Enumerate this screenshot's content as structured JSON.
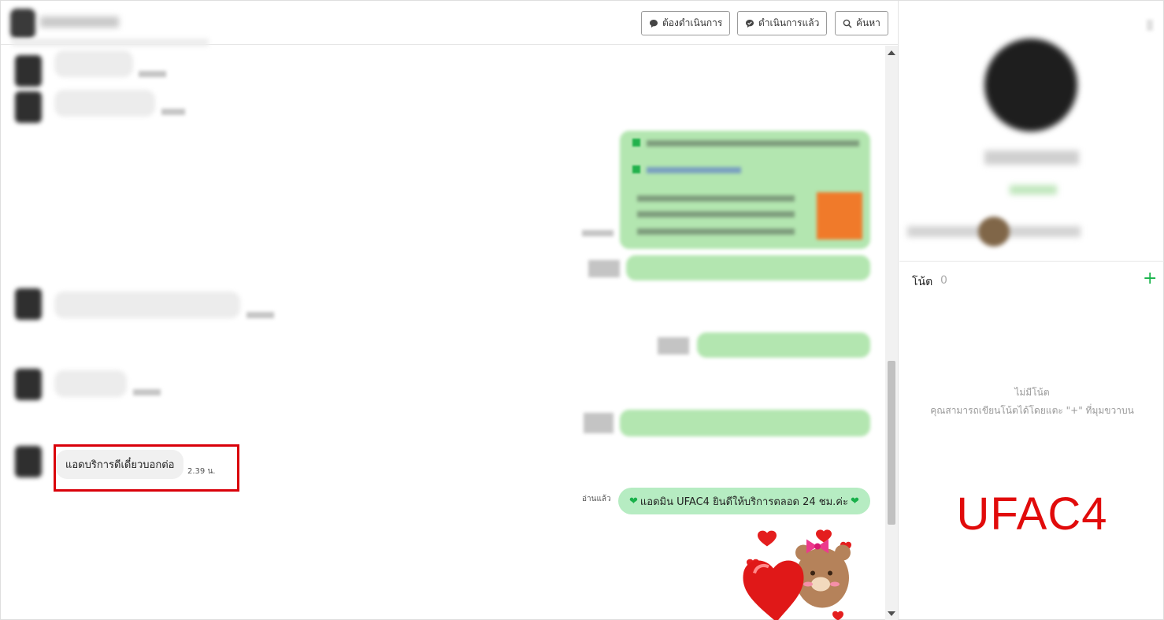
{
  "header": {
    "buttons": [
      {
        "label": "ต้องดำเนินการ",
        "icon": "chat-bubble-icon"
      },
      {
        "label": "ดำเนินการแล้ว",
        "icon": "chat-bubble-check-icon"
      },
      {
        "label": "ค้นหา",
        "icon": "search-icon"
      }
    ]
  },
  "messages": {
    "incoming_highlighted": {
      "text": "แอดบริการดีเดี๋ยวบอกต่อ",
      "time": "2.39 น."
    },
    "outgoing_last": {
      "read_status": "อ่านแล้ว",
      "text": "แอดมิน UFAC4 ยินดีให้บริการตลอด 24 ชม.ค่ะ"
    }
  },
  "sidebar": {
    "notes": {
      "label": "โน้ต",
      "count": "0",
      "add_icon": "plus-icon",
      "empty_title": "ไม่มีโน้ต",
      "empty_desc": "คุณสามารถเขียนโน้ตได้โดยแตะ \"+\" ที่มุมขวาบน"
    },
    "brand_overlay": "UFAC4"
  },
  "colors": {
    "accent_green": "#19b44b",
    "highlight_red": "#d9000a",
    "brand_red": "#e10b0b",
    "outgoing_bubble": "#b6ecc2"
  }
}
